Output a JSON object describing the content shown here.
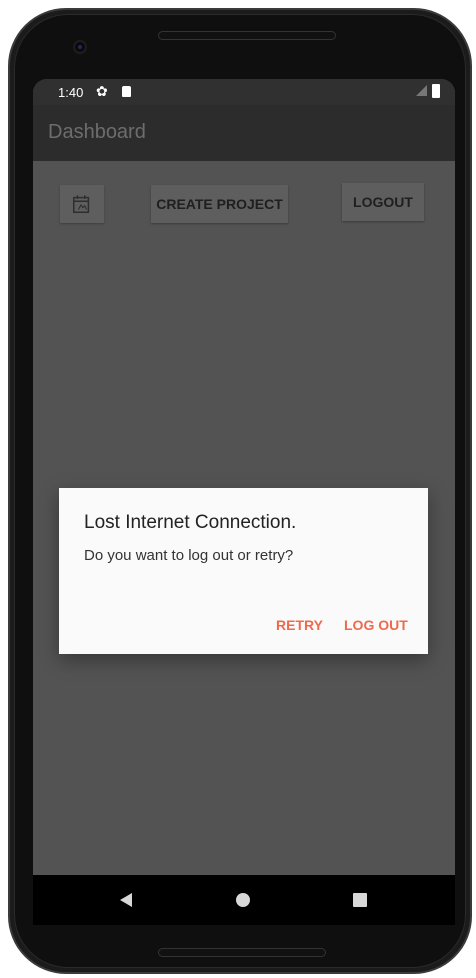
{
  "status_bar": {
    "time": "1:40",
    "icons": [
      "gear-icon",
      "sd-card-icon",
      "signal-icon",
      "battery-icon"
    ]
  },
  "app_bar": {
    "title": "Dashboard"
  },
  "toolbar": {
    "calendar_icon": "calendar-icon",
    "create_project_label": "CREATE PROJECT",
    "logout_label": "LOGOUT"
  },
  "dialog": {
    "title": "Lost Internet Connection.",
    "message": "Do you want to log out or retry?",
    "retry_label": "RETRY",
    "logout_label": "LOG OUT"
  },
  "nav_bar": {
    "icons": [
      "back-icon",
      "home-icon",
      "recents-icon"
    ]
  },
  "colors": {
    "accent": "#ee6a4e",
    "scrim": "#535353",
    "app_bar": "#2c2c2c",
    "status_bar": "#303030"
  }
}
